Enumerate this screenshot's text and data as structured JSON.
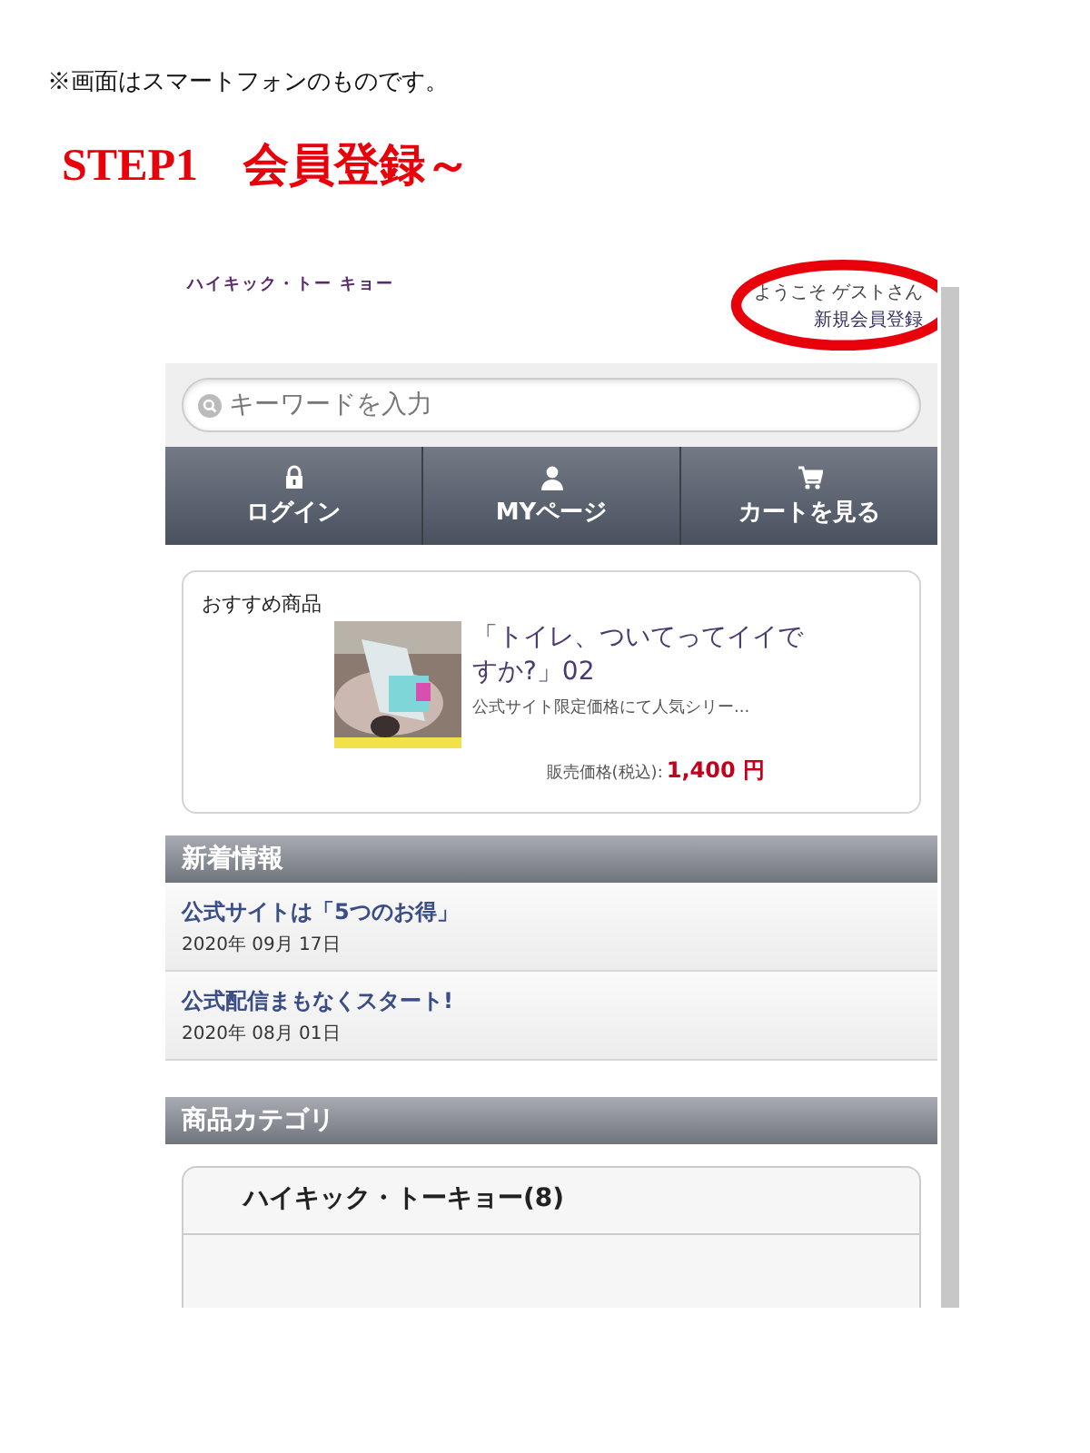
{
  "note": "※画面はスマートフォンのものです。",
  "step_title": "STEP1　会員登録～",
  "phone": {
    "logo": "ハイキック・トー キョー",
    "welcome": "ようこそ ゲストさん",
    "register_link": "新規会員登録",
    "highlight": true,
    "search": {
      "placeholder": "キーワードを入力"
    },
    "nav": [
      {
        "label": "ログイン",
        "kind": "lock"
      },
      {
        "label": "MYページ",
        "kind": "person"
      },
      {
        "label": "カートを見る",
        "kind": "cart"
      }
    ],
    "featured": {
      "heading": "おすすめ商品",
      "title": "「トイレ、ついてってイイですか?」02",
      "description": "公式サイト限定価格にて人気シリー...",
      "price_label": "販売価格(税込):",
      "price": "1,400 円"
    },
    "news": {
      "heading": "新着情報",
      "items": [
        {
          "title": "公式サイトは「5つのお得」",
          "date": "2020年 09月 17日"
        },
        {
          "title": "公式配信まもなくスタート!",
          "date": "2020年 08月 01日"
        }
      ]
    },
    "categories": {
      "heading": "商品カテゴリ",
      "items": [
        "ハイキック・トーキョー(8)"
      ]
    }
  }
}
